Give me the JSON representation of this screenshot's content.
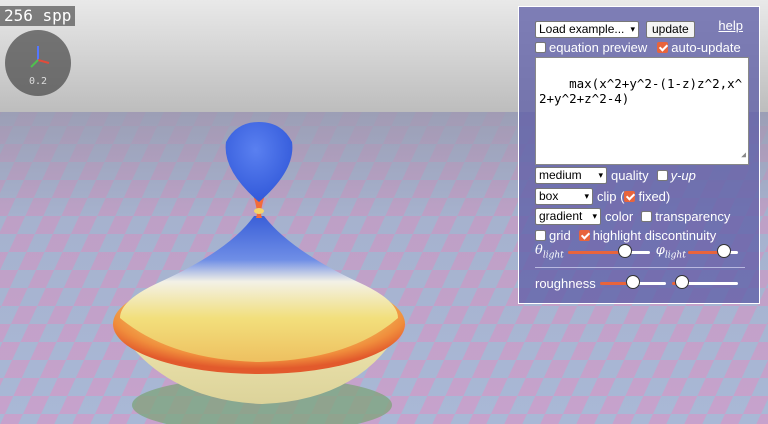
{
  "overlay": {
    "spp_text": "256 spp",
    "axes_scale": "0.2"
  },
  "panel": {
    "example_select": "Load example...",
    "update_label": "update",
    "help_label": "help",
    "equation_preview_label": "equation preview",
    "equation_preview_checked": false,
    "auto_update_label": "auto-update",
    "auto_update_checked": true,
    "equation": "max(x^2+y^2-(1-z)z^2,x^2+y^2+z^2-4)",
    "quality_select": "medium",
    "quality_label": "quality",
    "yup_label": "y-up",
    "yup_checked": false,
    "clip_select": "box",
    "clip_label": "clip (",
    "fixed_label": "fixed)",
    "fixed_checked": true,
    "color_select": "gradient",
    "color_label": "color",
    "transparency_label": "transparency",
    "transparency_checked": false,
    "grid_label": "grid",
    "grid_checked": false,
    "highlight_label": "highlight discontinuity",
    "highlight_checked": true,
    "theta_symbol": "θ",
    "theta_sub": "light",
    "phi_symbol": "φ",
    "phi_sub": "light",
    "theta_value": 0.74,
    "phi_value": 0.8,
    "roughness_label": "roughness",
    "roughness_value": 0.5,
    "second_slider_value": 0.06
  },
  "colors": {
    "accent": "#e8643c",
    "panel_bg": "#6060a8"
  }
}
